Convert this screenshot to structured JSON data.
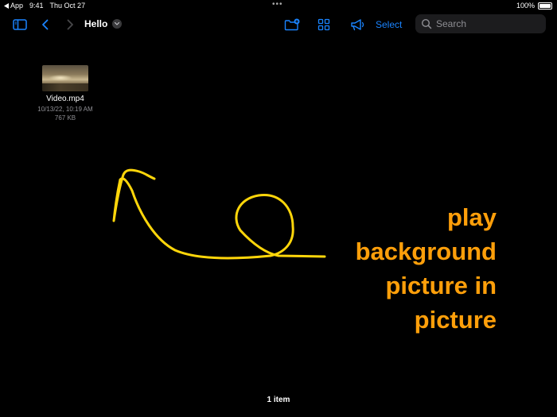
{
  "status_bar": {
    "back_app": "App",
    "time": "9:41",
    "date": "Thu Oct 27",
    "multitasking_dots": "•••",
    "battery": "100%"
  },
  "toolbar": {
    "title": "Hello",
    "select_label": "Select",
    "search_placeholder": "Search"
  },
  "icons": {
    "sidebar": "sidebar-icon",
    "back": "chevron-left-icon",
    "forward": "chevron-right-icon",
    "title_menu": "chevron-down-icon",
    "new_folder": "folder-badge-plus-icon",
    "view_options": "grid-icon",
    "announce": "megaphone-icon",
    "search": "search-icon"
  },
  "files": [
    {
      "name": "Video.mp4",
      "date": "10/13/22, 10:19 AM",
      "size": "767 KB"
    }
  ],
  "annotation": {
    "lines": [
      "play",
      "background",
      "picture in",
      "picture"
    ]
  },
  "footer": {
    "item_count": "1 item"
  },
  "colors": {
    "background": "#000000",
    "accent": "#1a84ff",
    "annotation_text": "#ff9f0a",
    "annotation_stroke": "#ffd60a",
    "secondary_text": "#8e8e93"
  }
}
